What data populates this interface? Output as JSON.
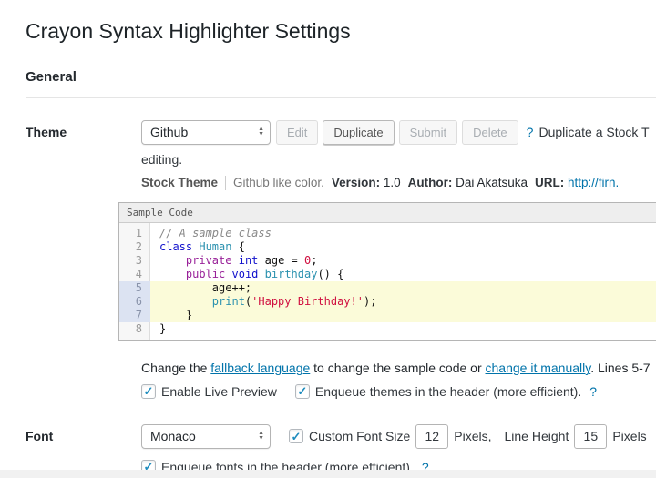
{
  "page": {
    "title": "Crayon Syntax Highlighter Settings",
    "section_heading": "General"
  },
  "theme": {
    "label": "Theme",
    "selected": "Github",
    "buttons": [
      {
        "label": "Edit",
        "enabled": false
      },
      {
        "label": "Duplicate",
        "enabled": true
      },
      {
        "label": "Submit",
        "enabled": false
      },
      {
        "label": "Delete",
        "enabled": false
      }
    ],
    "help": "?",
    "desc_line1": "Duplicate a Stock T",
    "desc_line2": "editing.",
    "stock": {
      "label": "Stock Theme",
      "desc": "Github like color.",
      "version_label": "Version:",
      "version": "1.0",
      "author_label": "Author:",
      "author": "Dai Akatsuka",
      "url_label": "URL:",
      "url": "http://firn."
    }
  },
  "sample": {
    "header": "Sample Code",
    "lines": [
      {
        "num": "1",
        "hl": false,
        "tokens": [
          {
            "t": "// A sample class",
            "c": "comment"
          }
        ]
      },
      {
        "num": "2",
        "hl": false,
        "tokens": [
          {
            "t": "class",
            "c": "kw"
          },
          {
            "t": " ",
            "c": "plain"
          },
          {
            "t": "Human",
            "c": "type"
          },
          {
            "t": " {",
            "c": "plain"
          }
        ]
      },
      {
        "num": "3",
        "hl": false,
        "tokens": [
          {
            "t": "    ",
            "c": "plain"
          },
          {
            "t": "private",
            "c": "mod"
          },
          {
            "t": " ",
            "c": "plain"
          },
          {
            "t": "int",
            "c": "kw"
          },
          {
            "t": " age = ",
            "c": "plain"
          },
          {
            "t": "0",
            "c": "num"
          },
          {
            "t": ";",
            "c": "plain"
          }
        ]
      },
      {
        "num": "4",
        "hl": false,
        "tokens": [
          {
            "t": "    ",
            "c": "plain"
          },
          {
            "t": "public",
            "c": "mod"
          },
          {
            "t": " ",
            "c": "plain"
          },
          {
            "t": "void",
            "c": "kw"
          },
          {
            "t": " ",
            "c": "plain"
          },
          {
            "t": "birthday",
            "c": "fn"
          },
          {
            "t": "() {",
            "c": "plain"
          }
        ]
      },
      {
        "num": "5",
        "hl": true,
        "tokens": [
          {
            "t": "        age++;",
            "c": "plain"
          }
        ]
      },
      {
        "num": "6",
        "hl": true,
        "tokens": [
          {
            "t": "        ",
            "c": "plain"
          },
          {
            "t": "print",
            "c": "fn"
          },
          {
            "t": "(",
            "c": "plain"
          },
          {
            "t": "'Happy Birthday!'",
            "c": "str"
          },
          {
            "t": ");",
            "c": "plain"
          }
        ]
      },
      {
        "num": "7",
        "hl": true,
        "tokens": [
          {
            "t": "    }",
            "c": "plain"
          }
        ]
      },
      {
        "num": "8",
        "hl": false,
        "tokens": [
          {
            "t": "}",
            "c": "plain"
          }
        ]
      }
    ]
  },
  "fallback": {
    "pre": "Change the ",
    "link1": "fallback language",
    "mid": " to change the sample code or ",
    "link2": "change it manually",
    "post": ". Lines 5-7"
  },
  "options": {
    "live_preview": "Enable Live Preview",
    "enqueue_themes": "Enqueue themes in the header (more efficient).",
    "help": "?"
  },
  "font": {
    "label": "Font",
    "selected": "Monaco",
    "custom_size_label": "Custom Font Size",
    "size_value": "12",
    "pixels_label": "Pixels,",
    "line_height_label": "Line Height",
    "line_height_value": "15",
    "pixels2_label": "Pixels",
    "enqueue_fonts": "Enqueue fonts in the header (more efficient).",
    "help": "?"
  },
  "colors": {
    "link": "#0073aa",
    "checkbox_check": "#1e8cbe",
    "code_highlight_bg": "#fbfbd9",
    "code_highlight_ln_bg": "#dce3f2"
  }
}
